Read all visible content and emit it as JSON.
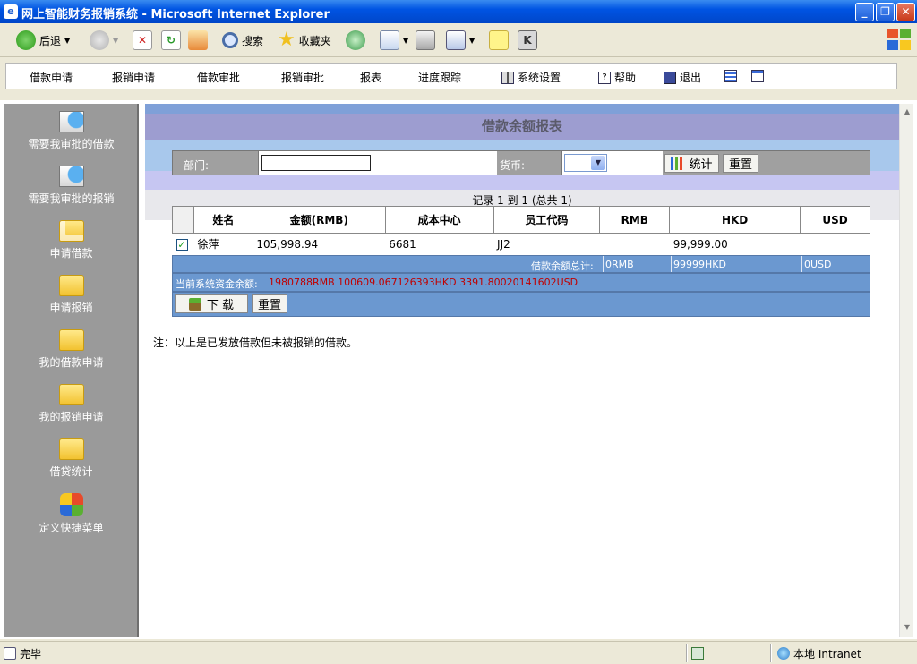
{
  "window": {
    "title": "网上智能财务报销系统 - Microsoft Internet Explorer",
    "buttons": {
      "minimize": "_",
      "restore": "❐",
      "close": "✕"
    }
  },
  "toolbar": {
    "back": "后退",
    "search": "搜索",
    "favorites": "收藏夹"
  },
  "nav": {
    "items": [
      "借款申请",
      "报销申请",
      "借款审批",
      "报销审批",
      "报表",
      "进度跟踪",
      "系统设置",
      "帮助",
      "退出"
    ]
  },
  "sidebar": {
    "items": [
      "需要我审批的借款",
      "需要我审批的报销",
      "申请借款",
      "申请报销",
      "我的借款申请",
      "我的报销申请",
      "借贷统计",
      "定义快捷菜单"
    ]
  },
  "report": {
    "title": "借款余额报表",
    "filter": {
      "dept_label": "部门:",
      "dept_value": "",
      "currency_label": "货币:",
      "currency_value": "",
      "stat_button": "统计",
      "reset_button": "重置"
    },
    "records_text": "记录 1 到 1 (总共 1)",
    "columns": [
      "姓名",
      "金额(RMB)",
      "成本中心",
      "员工代码",
      "RMB",
      "HKD",
      "USD"
    ],
    "rows": [
      {
        "checked": true,
        "name": "徐萍",
        "amount": "105,998.94",
        "cost_center": "6681",
        "emp_code": "JJ2",
        "rmb": "",
        "hkd": "99,999.00",
        "usd": ""
      }
    ],
    "summary": {
      "label": "借款余额总计:",
      "rmb": "0RMB",
      "hkd": "99999HKD",
      "usd": "0USD"
    },
    "balance": {
      "label": "当前系统资金余额:",
      "value": "1980788RMB 100609.067126393HKD 3391.80020141602USD"
    },
    "download_button": "下 载",
    "reset_button2": "重置",
    "note": "注：以上是已发放借款但未被报销的借款。"
  },
  "status": {
    "left": "完毕",
    "zone": "本地 Intranet"
  }
}
